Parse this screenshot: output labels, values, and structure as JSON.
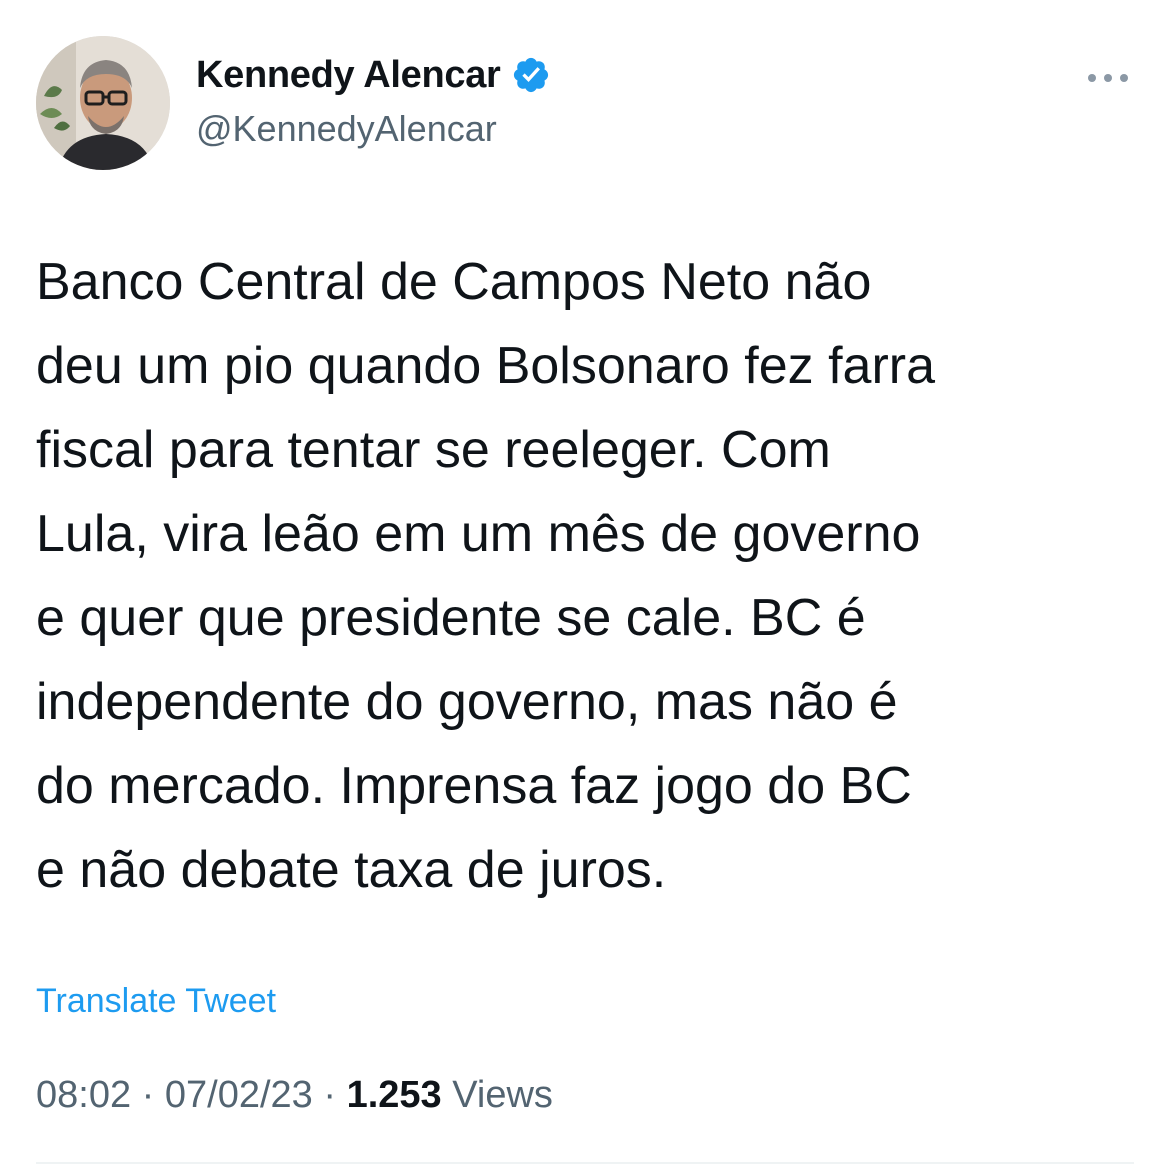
{
  "author": {
    "display_name": "Kennedy Alencar",
    "handle": "@KennedyAlencar",
    "verified_icon": "verified-badge-icon",
    "avatar_icon": "avatar"
  },
  "tweet": {
    "lines": [
      "Banco Central de Campos Neto não",
      "deu um pio quando Bolsonaro fez farra",
      "fiscal para tentar se reeleger. Com",
      "Lula, vira leão em um mês de governo",
      "e quer que presidente se cale. BC é",
      "independente do governo, mas não é",
      "do mercado. Imprensa faz jogo do BC",
      "e não debate taxa de juros."
    ],
    "translate_label": "Translate Tweet"
  },
  "meta": {
    "time": "08:02",
    "separator": "·",
    "date": "07/02/23",
    "views_count": "1.253",
    "views_label": "Views"
  },
  "colors": {
    "accent": "#1d9bf0",
    "text_primary": "#0f1419",
    "text_secondary": "#536471",
    "divider": "#eff3f4"
  },
  "icons": {
    "more": "more-dots-icon"
  }
}
